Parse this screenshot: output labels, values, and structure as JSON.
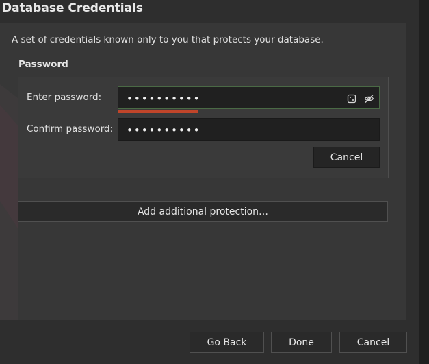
{
  "dialog": {
    "title": "Database Credentials",
    "description": "A set of credentials known only to you that protects your database."
  },
  "password_section": {
    "label": "Password",
    "enter_label": "Enter password:",
    "enter_value": "••••••••••",
    "confirm_label": "Confirm password:",
    "confirm_value": "••••••••••",
    "cancel_label": "Cancel",
    "generator_icon": "dice-icon",
    "visibility_icon": "eye-slash-icon",
    "strength_color": "#c0452a"
  },
  "add_protection_label": "Add additional protection…",
  "footer": {
    "go_back_label": "Go Back",
    "done_label": "Done",
    "cancel_label": "Cancel"
  }
}
